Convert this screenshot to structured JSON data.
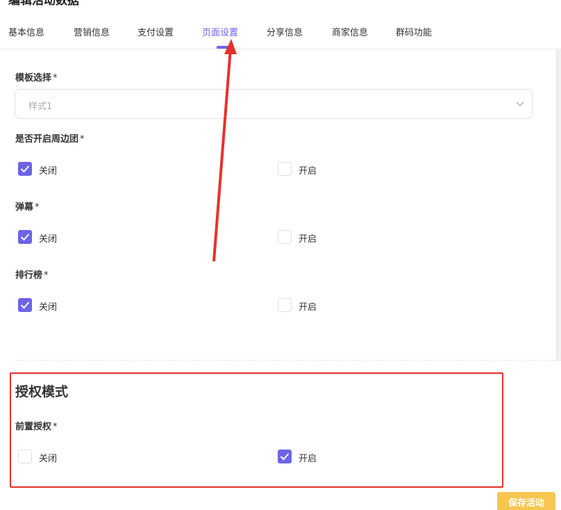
{
  "page": {
    "title": "编辑活动数据"
  },
  "tabs": [
    {
      "label": "基本信息"
    },
    {
      "label": "营销信息"
    },
    {
      "label": "支付设置"
    },
    {
      "label": "页面设置"
    },
    {
      "label": "分享信息"
    },
    {
      "label": "商家信息"
    },
    {
      "label": "群码功能"
    }
  ],
  "active_tab_index": 3,
  "template": {
    "label": "模板选择",
    "required_mark": "*",
    "value": "样式1"
  },
  "nearby_group": {
    "label": "是否开启周边团",
    "required_mark": "*",
    "options": [
      {
        "label": "关闭",
        "checked": true
      },
      {
        "label": "开启",
        "checked": false
      }
    ]
  },
  "barrage": {
    "label": "弹幕",
    "required_mark": "*",
    "options": [
      {
        "label": "关闭",
        "checked": true
      },
      {
        "label": "开启",
        "checked": false
      }
    ]
  },
  "leaderboard": {
    "label": "排行榜",
    "required_mark": "*",
    "options": [
      {
        "label": "关闭",
        "checked": true
      },
      {
        "label": "开启",
        "checked": false
      }
    ]
  },
  "auth_section": {
    "title": "授权模式",
    "pre_auth": {
      "label": "前置授权",
      "required_mark": "*",
      "options": [
        {
          "label": "关闭",
          "checked": false
        },
        {
          "label": "开启",
          "checked": true
        }
      ]
    }
  },
  "footer": {
    "save_label": "保存活动"
  },
  "colors": {
    "accent": "#6d63e8",
    "annotation_red": "#e8302a",
    "save_button": "#f6c650"
  }
}
